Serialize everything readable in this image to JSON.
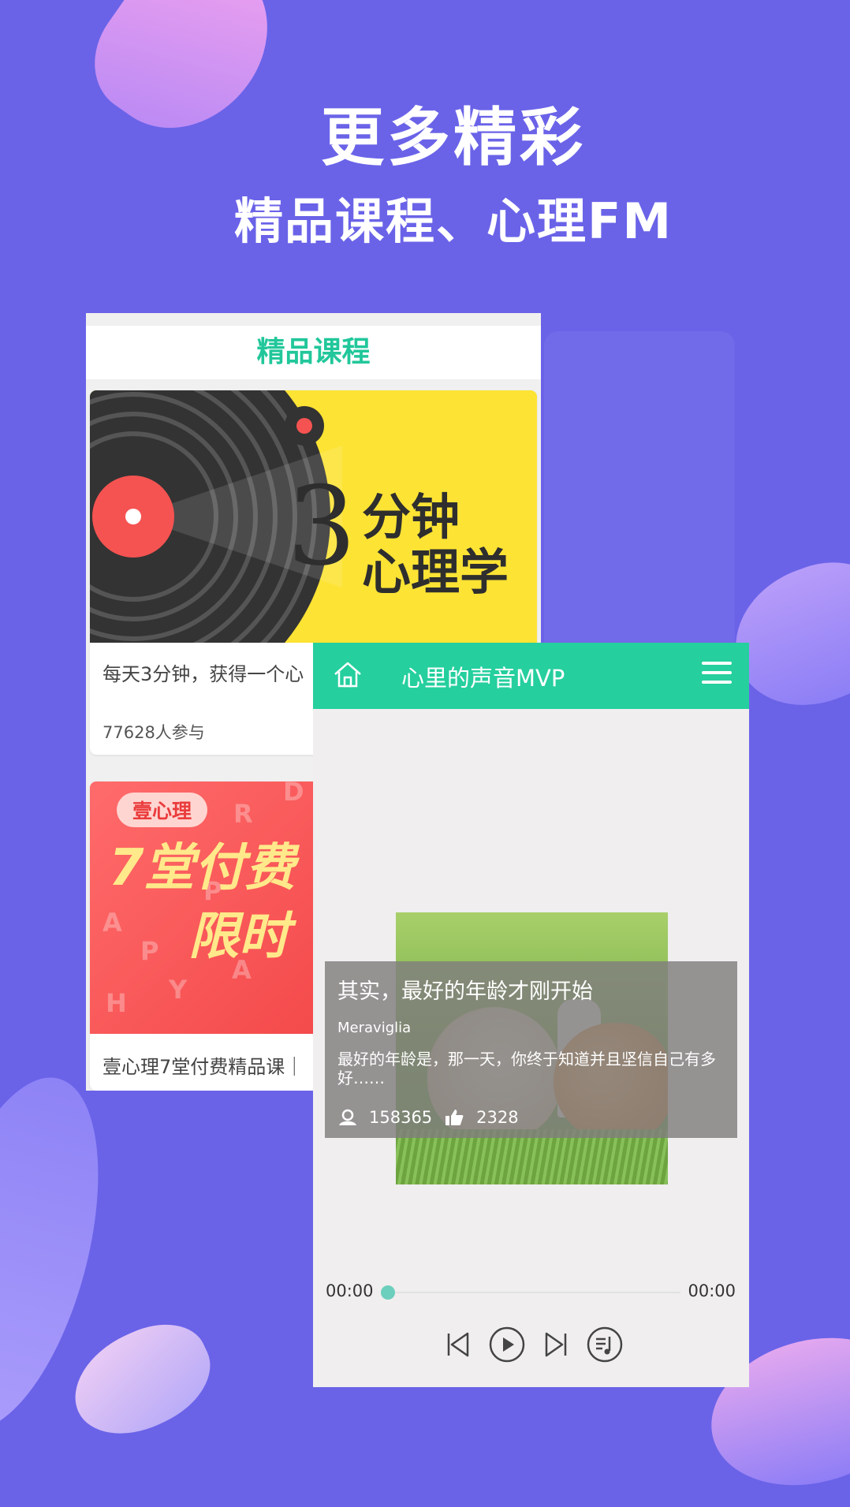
{
  "hero": {
    "title": "更多精彩",
    "subtitle": "精品课程、心理FM"
  },
  "left_panel": {
    "header": "精品课程",
    "courses": [
      {
        "brand_number": "3",
        "brand_line1": "分钟",
        "brand_line2": "心理学",
        "desc": "每天3分钟，获得一个心",
        "count": "77628人参与"
      },
      {
        "tag": "壹心理",
        "promo_line1": "7堂付费",
        "promo_line2": "限时",
        "desc": "壹心理7堂付费精品课｜"
      }
    ],
    "faded_letters": [
      "D",
      "R",
      "A",
      "P",
      "Y",
      "A",
      "H",
      "P"
    ]
  },
  "player": {
    "title": "心里的声音MVP",
    "track": {
      "title": "其实，最好的年龄才刚开始",
      "author": "Meraviglia",
      "desc": "最好的年龄是，那一天，你终于知道并且坚信自己有多好……",
      "listens": "158365",
      "likes": "2328"
    },
    "time_current": "00:00",
    "time_total": "00:00",
    "progress": 0
  },
  "colors": {
    "background": "#6a63e8",
    "accent": "#25cf9e",
    "course_title": "#21c79a"
  },
  "icons": [
    "home-icon",
    "menu-icon",
    "listener-icon",
    "thumbs-up-icon",
    "previous-icon",
    "play-icon",
    "next-icon",
    "playlist-icon"
  ]
}
